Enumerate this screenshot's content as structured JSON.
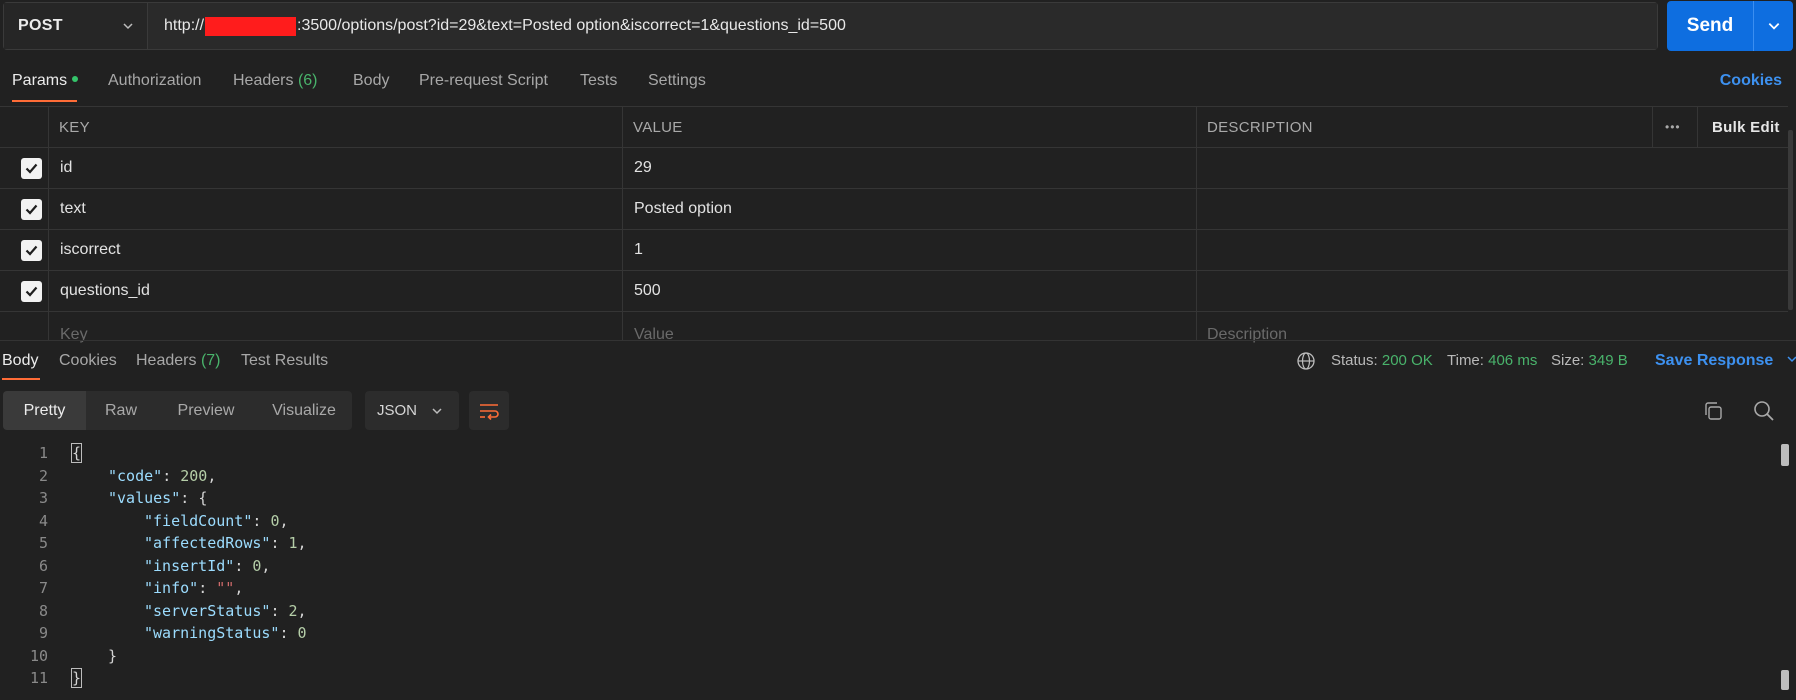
{
  "request": {
    "method": "POST",
    "url_prefix": "http://",
    "url_suffix": ":3500/options/post?id=29&text=Posted option&iscorrect=1&questions_id=500",
    "send_label": "Send"
  },
  "request_tabs": {
    "params": "Params",
    "authorization": "Authorization",
    "headers": "Headers",
    "headers_count": "(6)",
    "body": "Body",
    "prerequest": "Pre-request Script",
    "tests": "Tests",
    "settings": "Settings",
    "cookies": "Cookies"
  },
  "params": {
    "headers": {
      "key": "KEY",
      "value": "VALUE",
      "description": "DESCRIPTION",
      "more": "•••",
      "bulk_edit": "Bulk Edit"
    },
    "rows": [
      {
        "key": "id",
        "value": "29",
        "description": ""
      },
      {
        "key": "text",
        "value": "Posted option",
        "description": ""
      },
      {
        "key": "iscorrect",
        "value": "1",
        "description": ""
      },
      {
        "key": "questions_id",
        "value": "500",
        "description": ""
      }
    ],
    "placeholder": {
      "key": "Key",
      "value": "Value",
      "description": "Description"
    }
  },
  "response_tabs": {
    "body": "Body",
    "cookies": "Cookies",
    "headers": "Headers",
    "headers_count": "(7)",
    "test_results": "Test Results"
  },
  "response_status": {
    "status_label": "Status:",
    "status_value": "200 OK",
    "time_label": "Time:",
    "time_value": "406 ms",
    "size_label": "Size:",
    "size_value": "349 B",
    "save_response": "Save Response"
  },
  "view_modes": {
    "pretty": "Pretty",
    "raw": "Raw",
    "preview": "Preview",
    "visualize": "Visualize"
  },
  "format": "JSON",
  "code": {
    "line_numbers": [
      "1",
      "2",
      "3",
      "4",
      "5",
      "6",
      "7",
      "8",
      "9",
      "10",
      "11"
    ],
    "open_brace": "{",
    "close_brace": "}",
    "code_key": "\"code\"",
    "code_val": "200",
    "values_key": "\"values\"",
    "fieldCount_key": "\"fieldCount\"",
    "fieldCount_val": "0",
    "affectedRows_key": "\"affectedRows\"",
    "affectedRows_val": "1",
    "insertId_key": "\"insertId\"",
    "insertId_val": "0",
    "info_key": "\"info\"",
    "info_val": "\"\"",
    "serverStatus_key": "\"serverStatus\"",
    "serverStatus_val": "2",
    "warningStatus_key": "\"warningStatus\"",
    "warningStatus_val": "0"
  },
  "colors": {
    "accent": "#ff6c37",
    "send": "#0e6ee0",
    "link": "#3d91f0",
    "success": "#49b36b"
  }
}
